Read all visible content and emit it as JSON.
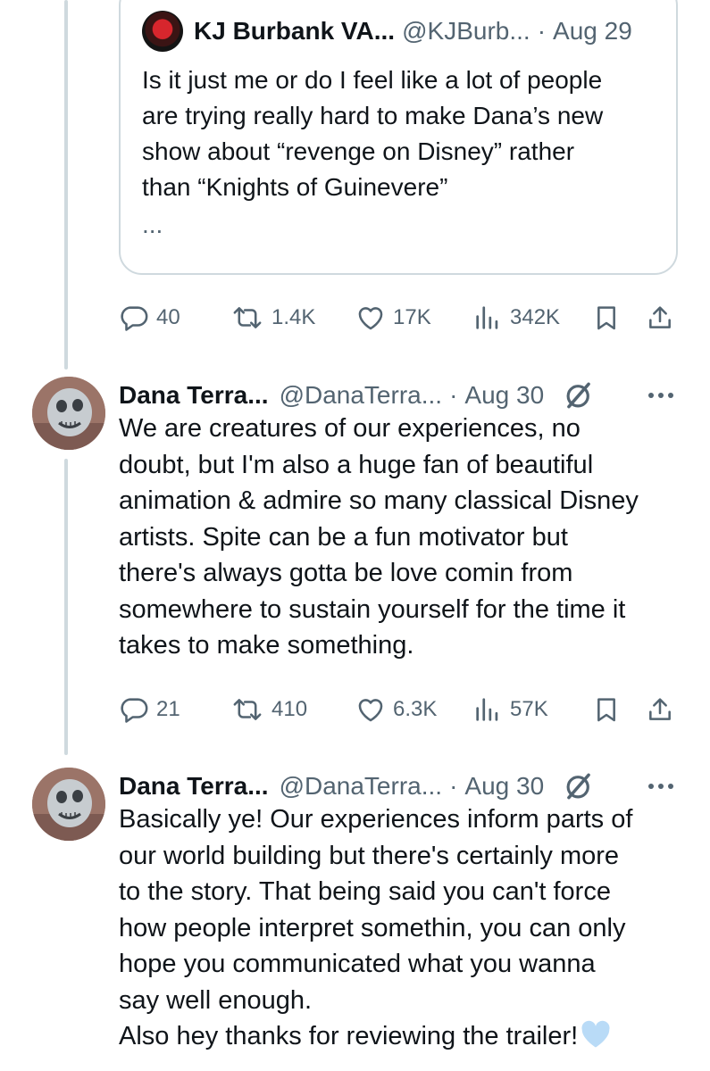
{
  "quoted_tweet": {
    "display_name": "KJ Burbank VA...",
    "handle": "@KJBurb...",
    "date": "Aug 29",
    "text": "Is it just me or do I feel like a lot of people\nare trying really hard to make Dana’s new\nshow about “revenge on Disney” rather\nthan “Knights of Guinevere”",
    "truncation": "..."
  },
  "tweets": [
    {
      "stats": {
        "replies": "40",
        "retweets": "1.4K",
        "likes": "17K",
        "views": "342K"
      }
    },
    {
      "display_name": "Dana Terra...",
      "handle": "@DanaTerra...",
      "date": "Aug 30",
      "text": "We are creatures of our experiences, no\ndoubt, but I'm also a huge fan of beautiful\nanimation & admire so many classical Disney\nartists. Spite can be a fun motivator but\nthere's always gotta be love comin from\nsomewhere to sustain yourself for the time it\ntakes to make something.",
      "stats": {
        "replies": "21",
        "retweets": "410",
        "likes": "6.3K",
        "views": "57K"
      }
    },
    {
      "display_name": "Dana Terra...",
      "handle": "@DanaTerra...",
      "date": "Aug 30",
      "text": "Basically ye! Our experiences inform parts of\nour world building but there's certainly more\nto the story. That being said you can't force\nhow people interpret somethin, you can only\nhope you communicated what you wanna\nsay well enough.\nAlso hey thanks for reviewing the trailer!"
    }
  ],
  "separator_dot": "·",
  "icons": {
    "reply": "reply-bubble-icon",
    "retweet": "retweet-icon",
    "like": "heart-outline-icon",
    "views": "views-bar-chart-icon",
    "bookmark": "bookmark-icon",
    "share": "share-upload-icon",
    "grok": "grok-slash-circle-icon",
    "more": "more-dots-icon",
    "emoji": "blue-heart-emoji"
  },
  "colors": {
    "text": "#0f1419",
    "secondary": "#536471",
    "border": "#cfd9de",
    "emoji_heart": "#b9dbf7"
  }
}
